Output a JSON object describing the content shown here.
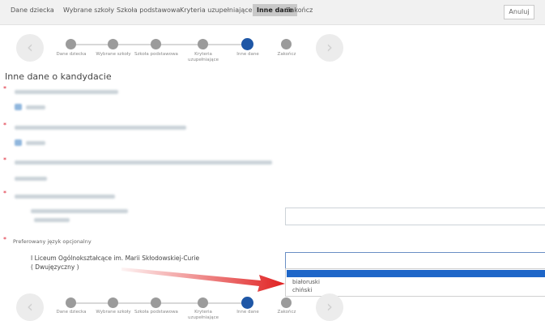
{
  "tabs": [
    "Dane dziecka",
    "Wybrane szkoły",
    "Szkoła podstawowa",
    "Kryteria uzupełniające",
    "Inne dane",
    "Zakończ"
  ],
  "active_tab": "Inne dane",
  "cancel_label": "Anuluj",
  "steps": [
    "Dane dziecka",
    "Wybrane szkoły",
    "Szkoła podstawowa",
    "Kryteria uzupełniające",
    "Inne dane",
    "Zakończ"
  ],
  "active_step": "Inne dane",
  "nav": {
    "prev_glyph": "‹",
    "next_glyph": "›"
  },
  "section_title": "Inne dane o kandydacie",
  "required_marker": "*",
  "language_label": "Preferowany język opcjonalny",
  "school": {
    "line1": "I Liceum Ogólnokształcące im. Marii Skłodowskiej-Curie",
    "line2": "( Dwujęzyczny )"
  },
  "language_select": {
    "selected": "",
    "options": [
      "",
      "białoruski",
      "chiński"
    ]
  },
  "colors": {
    "active_step": "#1f57a6",
    "selected_option": "#1e66c8",
    "arrow": "#e02020",
    "required": "#d22233"
  }
}
